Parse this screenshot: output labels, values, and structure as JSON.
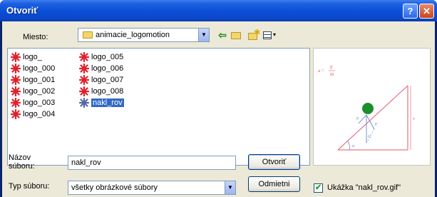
{
  "window": {
    "title": "Otvoriť",
    "help_label": "?",
    "close_label": "✕"
  },
  "lookin": {
    "label": "Miesto:",
    "value": "animacie_logomotion"
  },
  "files": [
    {
      "name": "logo_",
      "col": 0,
      "row": 0
    },
    {
      "name": "logo_000",
      "col": 0,
      "row": 1
    },
    {
      "name": "logo_001",
      "col": 0,
      "row": 2
    },
    {
      "name": "logo_002",
      "col": 0,
      "row": 3
    },
    {
      "name": "logo_003",
      "col": 0,
      "row": 4
    },
    {
      "name": "logo_004",
      "col": 0,
      "row": 5
    },
    {
      "name": "logo_005",
      "col": 1,
      "row": 0
    },
    {
      "name": "logo_006",
      "col": 1,
      "row": 1
    },
    {
      "name": "logo_007",
      "col": 1,
      "row": 2
    },
    {
      "name": "logo_008",
      "col": 1,
      "row": 3
    },
    {
      "name": "nakl_rov",
      "col": 1,
      "row": 4,
      "selected": true
    }
  ],
  "filename": {
    "label": "Názov súboru:",
    "value": "nakl_rov"
  },
  "filetype": {
    "label": "Typ súboru:",
    "value": "všetky obrázkové súbory"
  },
  "buttons": {
    "open": "Otvoriť",
    "cancel": "Odmietni"
  },
  "preview": {
    "checkbox_label": "Ukážka \"nakl_rov.gif\"",
    "checked": true,
    "formula_lhs": "a =",
    "formula_num": "F",
    "formula_den": "m"
  },
  "colors": {
    "titlebar": "#0a4fd8",
    "selection": "#316ac5",
    "file_icon": "#e0202a",
    "preview_lines": "#e35a6a"
  }
}
